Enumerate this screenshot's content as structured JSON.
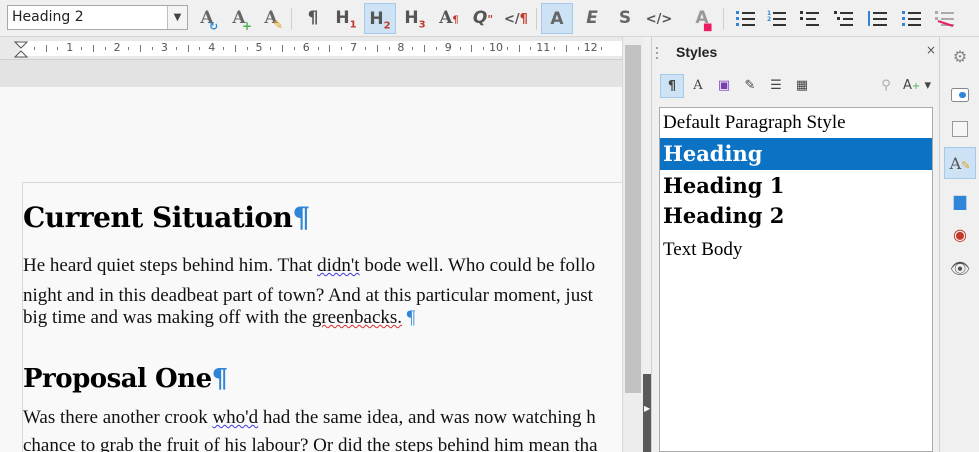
{
  "toolbar": {
    "paragraph_style_value": "Heading 2",
    "items": [
      {
        "name": "update-style-icon",
        "glyph": "A"
      },
      {
        "name": "new-style-icon",
        "glyph": "A"
      },
      {
        "name": "edit-style-icon",
        "glyph": "A"
      },
      {
        "name": "default-paragraph-icon",
        "glyph": "¶"
      },
      {
        "name": "heading-1-icon",
        "glyph": "H1"
      },
      {
        "name": "heading-2-icon",
        "glyph": "H2"
      },
      {
        "name": "heading-3-icon",
        "glyph": "H3"
      },
      {
        "name": "text-body-icon",
        "glyph": "A¶"
      },
      {
        "name": "quotations-icon",
        "glyph": "Q\""
      },
      {
        "name": "preformatted-icon",
        "glyph": "</¶"
      },
      {
        "name": "emphasis-strong-icon",
        "glyph": "A"
      },
      {
        "name": "emphasis-icon",
        "glyph": "E"
      },
      {
        "name": "strong-emphasis-icon",
        "glyph": "S"
      },
      {
        "name": "source-text-icon",
        "glyph": "</>"
      },
      {
        "name": "no-character-style-icon",
        "glyph": "A"
      }
    ]
  },
  "ruler": {
    "numbers": [
      "1",
      "2",
      "3",
      "4",
      "5",
      "6",
      "7",
      "8",
      "9",
      "10",
      "11",
      "12"
    ]
  },
  "document": {
    "heading1": "Current Situation",
    "paragraph1": [
      [
        "He heard quiet steps behind him. That ",
        "didn't",
        " bode well. Who could be follo"
      ],
      [
        "night and in this deadbeat part of town? And at this particular moment, just"
      ],
      [
        "big time and was making off with the ",
        "greenbacks.",
        " "
      ]
    ],
    "heading2": "Proposal One",
    "paragraph2": [
      [
        "Was there another crook ",
        "who'd",
        " had the same idea, and was now watching h"
      ],
      [
        "chance to grab the fruit of his labour? Or did the steps behind him mean tha"
      ]
    ],
    "pilcrow": "¶"
  },
  "styles_panel": {
    "title": "Styles",
    "close": "×",
    "styles": [
      {
        "label": "Default Paragraph Style",
        "kind": "default",
        "selected": false
      },
      {
        "label": "Heading",
        "kind": "heading",
        "selected": true
      },
      {
        "label": "Heading 1",
        "kind": "heading",
        "selected": false
      },
      {
        "label": "Heading 2",
        "kind": "heading",
        "selected": false
      },
      {
        "label": "Text Body",
        "kind": "default",
        "selected": false
      }
    ]
  },
  "colors": {
    "accent": "#0b72c4",
    "pilcrow": "#2f86d6",
    "active_button": "#cde3f5"
  }
}
